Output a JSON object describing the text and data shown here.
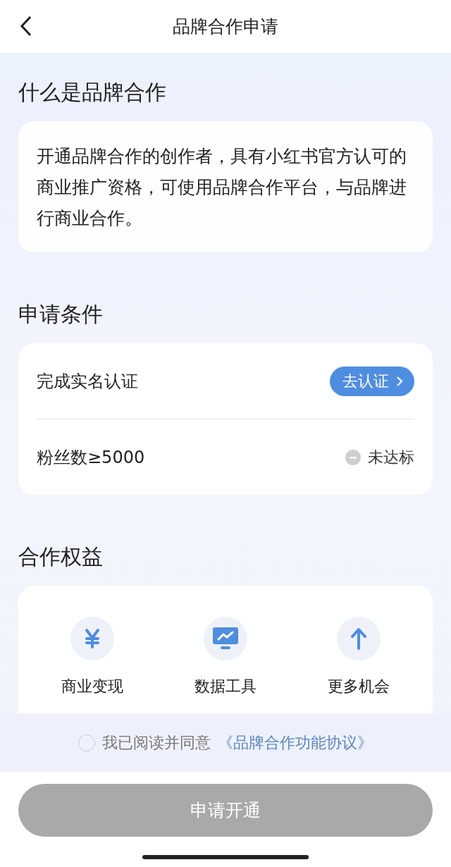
{
  "header": {
    "title": "品牌合作申请"
  },
  "intro": {
    "title": "什么是品牌合作",
    "text": "开通品牌合作的创作者，具有小红书官方认可的商业推广资格，可使用品牌合作平台，与品牌进行商业合作。"
  },
  "conditions": {
    "title": "申请条件",
    "items": [
      {
        "kind": "action",
        "label": "完成实名认证",
        "action": "去认证"
      },
      {
        "kind": "status",
        "label": "粉丝数≥5000",
        "status": "未达标"
      }
    ]
  },
  "benefits": {
    "title": "合作权益",
    "items": [
      {
        "kind": "money",
        "name": "商业变现"
      },
      {
        "kind": "data",
        "name": "数据工具"
      },
      {
        "kind": "growth",
        "name": "更多机会"
      }
    ]
  },
  "agreement": {
    "checked": false,
    "text": "我已阅读并同意",
    "link": "《品牌合作功能协议》"
  },
  "submit": {
    "label": "申请开通",
    "disabled": true
  }
}
